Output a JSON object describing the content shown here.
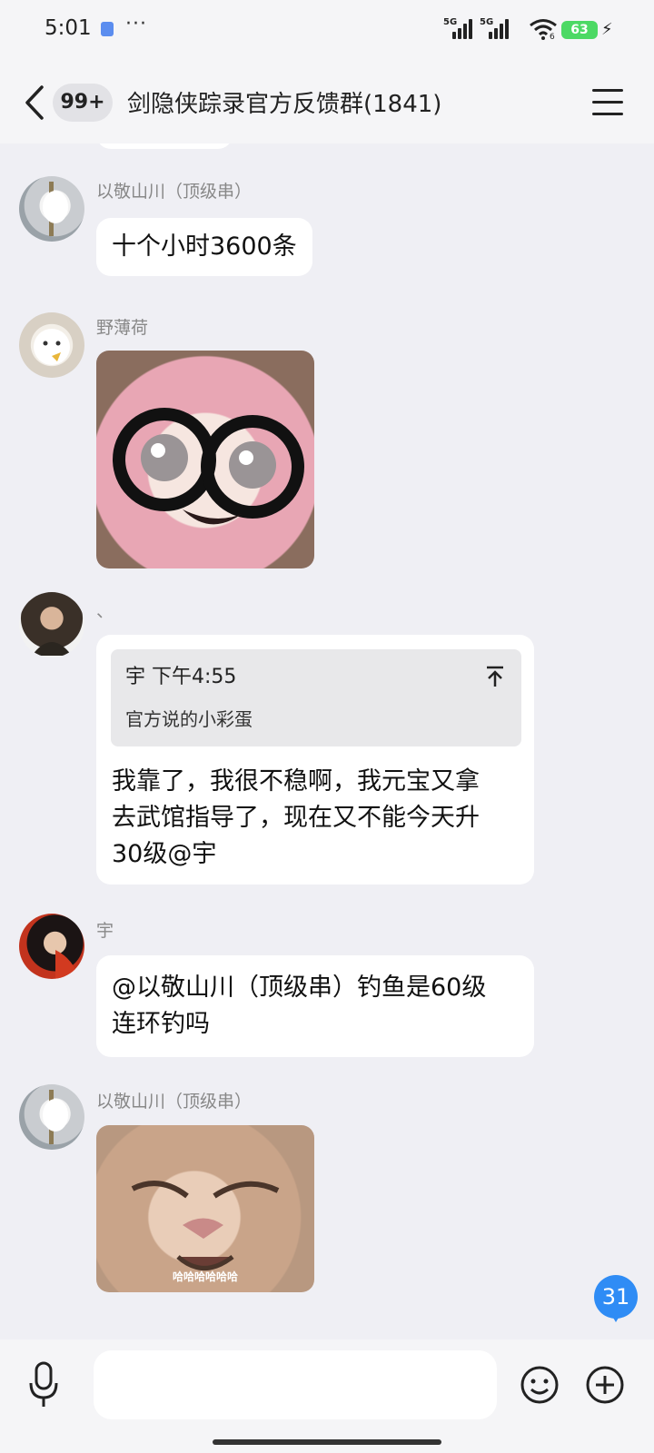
{
  "status_bar": {
    "time": "5:01",
    "more": "···",
    "network_1": "5G",
    "network_2": "5G",
    "wifi_sub": "6",
    "battery": "63"
  },
  "header": {
    "unread_badge": "99+",
    "title": "剑隐侠踪录官方反馈群(1841)"
  },
  "messages": [
    {
      "sender": "以敬山川（顶级串）",
      "text": "十个小时3600条"
    },
    {
      "sender": "野薄荷",
      "image": "glasses-plush-sticker"
    },
    {
      "sender": "、",
      "quote_header": "宇 下午4:55",
      "quote_text": "官方说的小彩蛋",
      "text_line1": "我靠了，我很不稳啊，我元宝又拿",
      "text_line2": "去武馆指导了，现在又不能今天升",
      "text_line3": "30级@宇"
    },
    {
      "sender": "宇",
      "text_line1": "@以敬山川（顶级串）钓鱼是60级",
      "text_line2": "连环钓吗"
    },
    {
      "sender": "以敬山川（顶级串）",
      "image": "laughing-cat-sticker",
      "image_caption": "哈哈哈哈哈哈"
    }
  ],
  "new_message_count": "31",
  "colors": {
    "accent": "#2f8cf5",
    "bubble": "#ffffff",
    "background": "#efeff4"
  }
}
